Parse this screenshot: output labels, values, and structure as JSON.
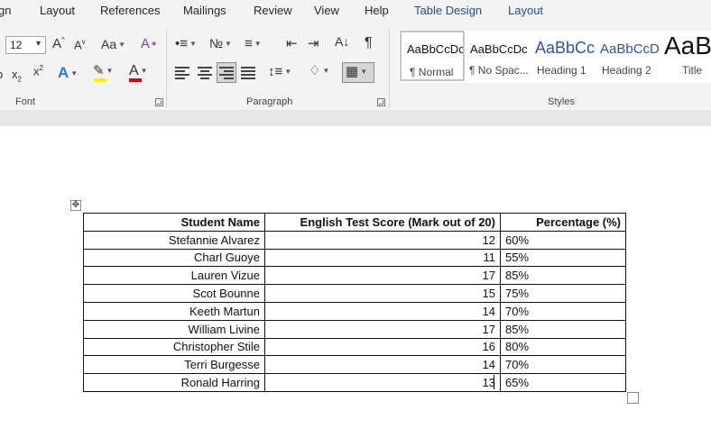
{
  "menu": {
    "tabs": [
      "gn",
      "Layout",
      "References",
      "Mailings",
      "Review",
      "View",
      "Help",
      "Table Design",
      "Layout"
    ]
  },
  "ribbon": {
    "font_size": "12",
    "groups": {
      "font": "Font",
      "paragraph": "Paragraph",
      "styles": "Styles"
    },
    "styles": [
      {
        "sample": "AaBbCcDc",
        "name": "¶ Normal"
      },
      {
        "sample": "AaBbCcDc",
        "name": "¶ No Spac..."
      },
      {
        "sample": "AaBbCc",
        "name": "Heading 1"
      },
      {
        "sample": "AaBbCcD",
        "name": "Heading 2"
      },
      {
        "sample": "AaB",
        "name": "Title"
      }
    ],
    "colors": {
      "highlight": "#ffef00",
      "font_color": "#e00000",
      "heading_blue": "#2f5496"
    }
  },
  "table": {
    "headers": [
      "Student Name",
      "English Test Score (Mark out of 20)",
      "Percentage (%)"
    ],
    "rows": [
      [
        "Stefannie Alvarez",
        "12",
        "60%"
      ],
      [
        "Charl Guoye",
        "11",
        "55%"
      ],
      [
        "Lauren Vizue",
        "17",
        "85%"
      ],
      [
        "Scot Bounne",
        "15",
        "75%"
      ],
      [
        "Keeth Martun",
        "14",
        "70%"
      ],
      [
        "William Livine",
        "17",
        "85%"
      ],
      [
        "Christopher Stile",
        "16",
        "80%"
      ],
      [
        "Terri Burgesse",
        "14",
        "70%"
      ],
      [
        "Ronald Harring",
        "13",
        "65%"
      ]
    ]
  }
}
